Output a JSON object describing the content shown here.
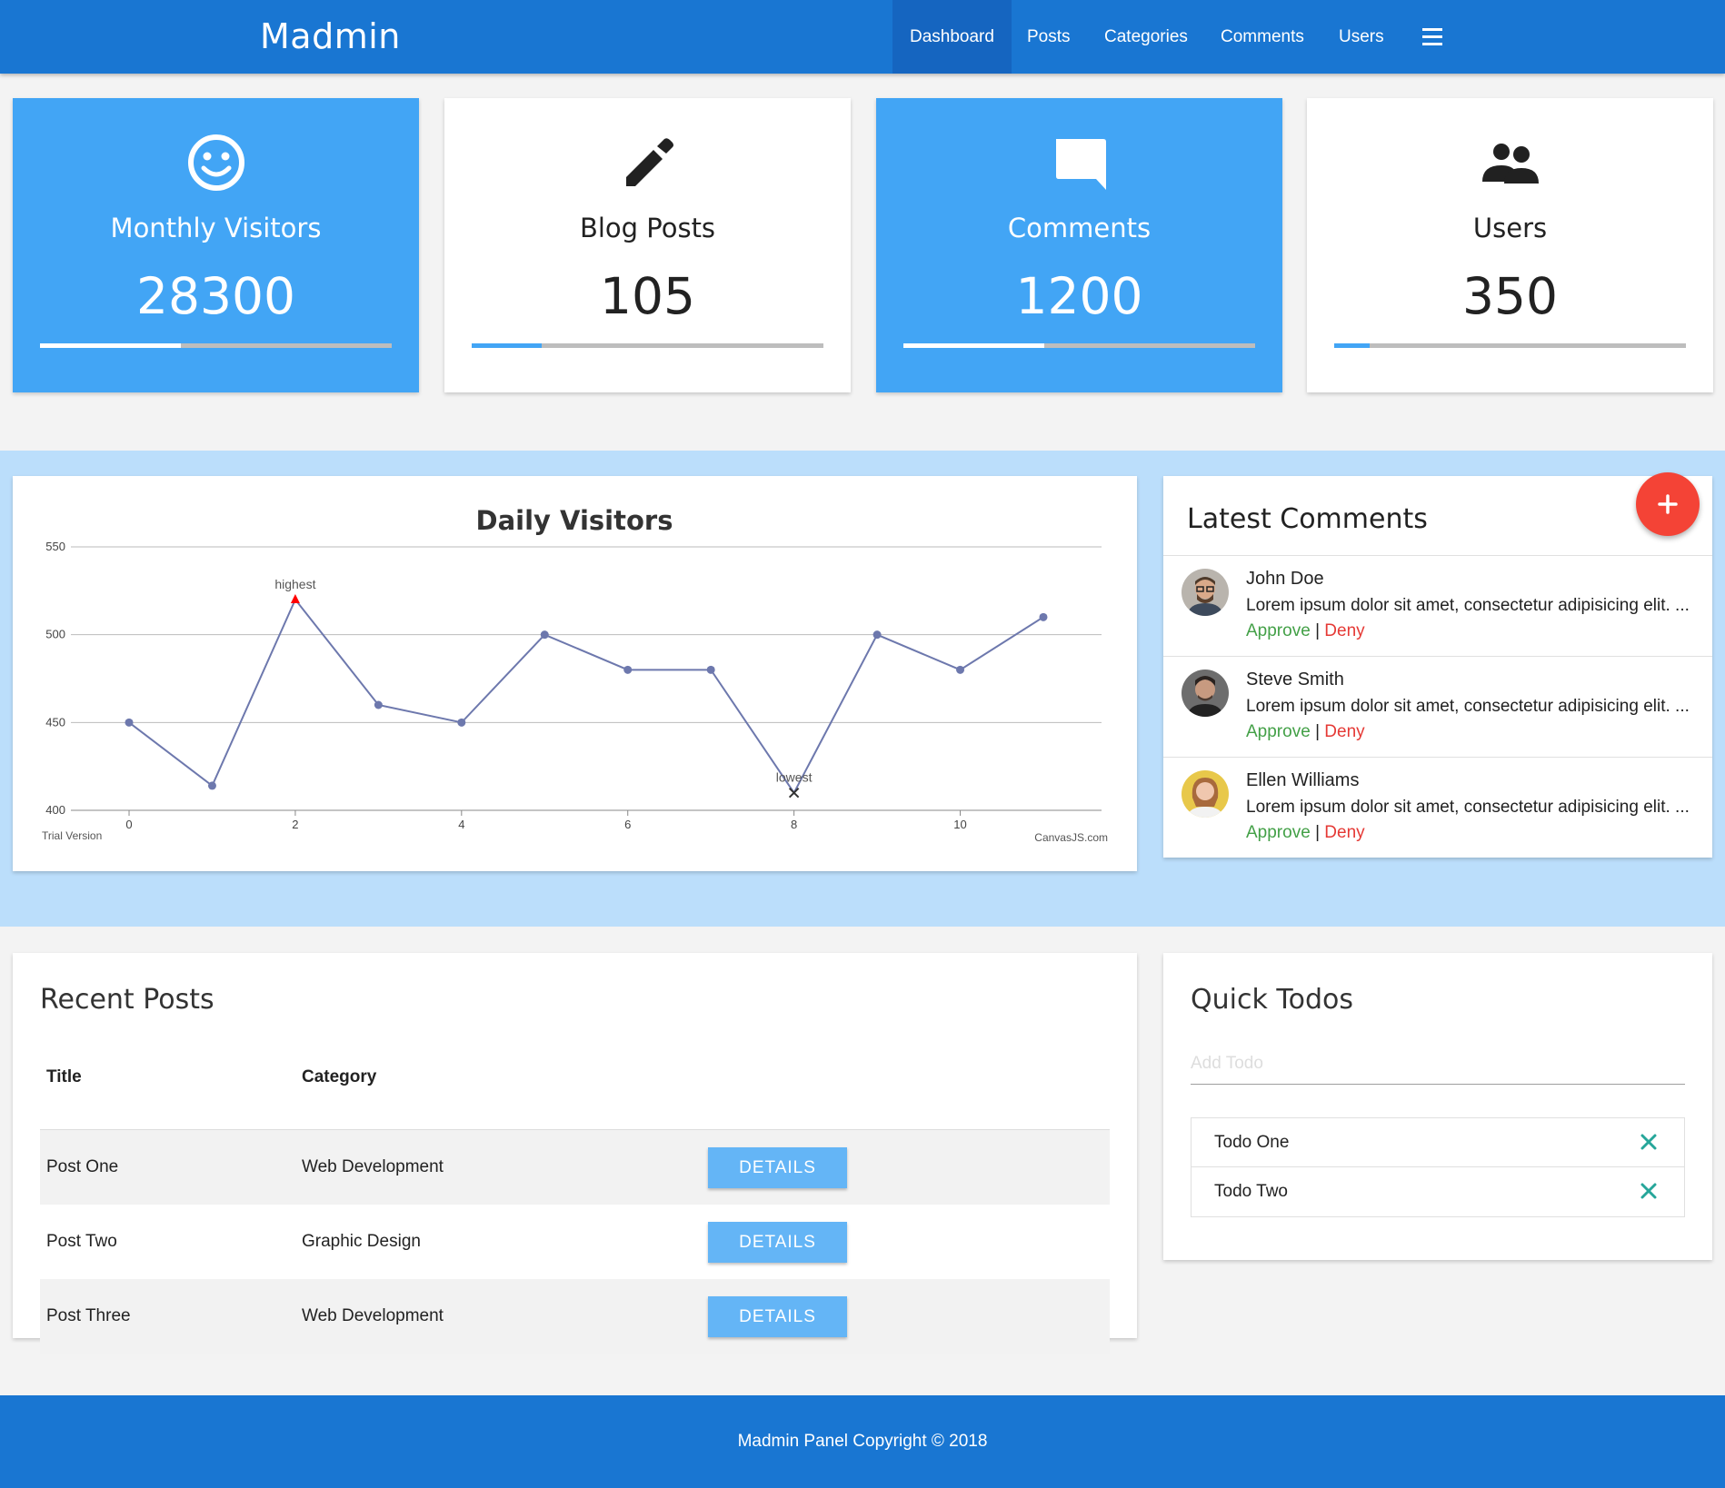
{
  "navbar": {
    "brand": "Madmin",
    "items": [
      {
        "label": "Dashboard",
        "active": true
      },
      {
        "label": "Posts"
      },
      {
        "label": "Categories"
      },
      {
        "label": "Comments"
      },
      {
        "label": "Users"
      }
    ],
    "menu_icon": "hamburger-menu-icon"
  },
  "stats": [
    {
      "label": "Monthly Visitors",
      "value": "28300",
      "icon": "smiley-icon",
      "progress": 0.4,
      "style": "blue"
    },
    {
      "label": "Blog Posts",
      "value": "105",
      "icon": "pencil-icon",
      "progress": 0.2,
      "style": "white"
    },
    {
      "label": "Comments",
      "value": "1200",
      "icon": "comment-icon",
      "progress": 0.4,
      "style": "blue"
    },
    {
      "label": "Users",
      "value": "350",
      "icon": "users-icon",
      "progress": 0.1,
      "style": "white"
    }
  ],
  "chart_data": {
    "type": "line",
    "title": "Daily Visitors",
    "x": [
      0,
      1,
      2,
      3,
      4,
      5,
      6,
      7,
      8,
      9,
      10,
      11
    ],
    "series": [
      {
        "values": [
          450,
          414,
          520,
          460,
          450,
          500,
          480,
          480,
          410,
          500,
          480,
          510
        ]
      }
    ],
    "xticks": [
      0,
      2,
      4,
      6,
      8,
      10
    ],
    "yticks": [
      400,
      450,
      500,
      550
    ],
    "ylim": [
      400,
      550
    ],
    "xlim": [
      -0.7,
      11.7
    ],
    "grid": true,
    "annotations": [
      {
        "x": 2,
        "label": "highest",
        "marker": "triangle",
        "color": "#ff0000"
      },
      {
        "x": 8,
        "label": "lowest",
        "marker": "cross",
        "color": "#333333"
      }
    ],
    "line_color": "#6d78ad",
    "watermark_left": "Trial Version",
    "watermark_right": "CanvasJS.com"
  },
  "comments": {
    "title": "Latest Comments",
    "add_icon": "plus-icon",
    "items": [
      {
        "name": "John Doe",
        "text": "Lorem ipsum dolor sit amet, consectetur adipisicing elit. ...",
        "approve": "Approve",
        "deny": "Deny",
        "separator": "|"
      },
      {
        "name": "Steve Smith",
        "text": "Lorem ipsum dolor sit amet, consectetur adipisicing elit. ...",
        "approve": "Approve",
        "deny": "Deny",
        "separator": "|"
      },
      {
        "name": "Ellen Williams",
        "text": "Lorem ipsum dolor sit amet, consectetur adipisicing elit. ...",
        "approve": "Approve",
        "deny": "Deny",
        "separator": "|"
      }
    ]
  },
  "posts": {
    "title": "Recent Posts",
    "columns": [
      "Title",
      "Category"
    ],
    "rows": [
      {
        "title": "Post One",
        "category": "Web Development",
        "button": "DETAILS"
      },
      {
        "title": "Post Two",
        "category": "Graphic Design",
        "button": "DETAILS"
      },
      {
        "title": "Post Three",
        "category": "Web Development",
        "button": "DETAILS"
      }
    ]
  },
  "todos": {
    "title": "Quick Todos",
    "placeholder": "Add Todo",
    "items": [
      {
        "text": "Todo One",
        "remove_icon": "close-icon"
      },
      {
        "text": "Todo Two",
        "remove_icon": "close-icon"
      }
    ]
  },
  "footer": {
    "text": "Madmin Panel Copyright © 2018"
  },
  "colors": {
    "primary": "#1976d2",
    "stat_blue": "#42a5f5",
    "band": "#bbdefb",
    "fab": "#f44336",
    "approve": "#43a047",
    "deny": "#e53935",
    "button": "#64b5f6",
    "todo_x": "#26a69a"
  }
}
